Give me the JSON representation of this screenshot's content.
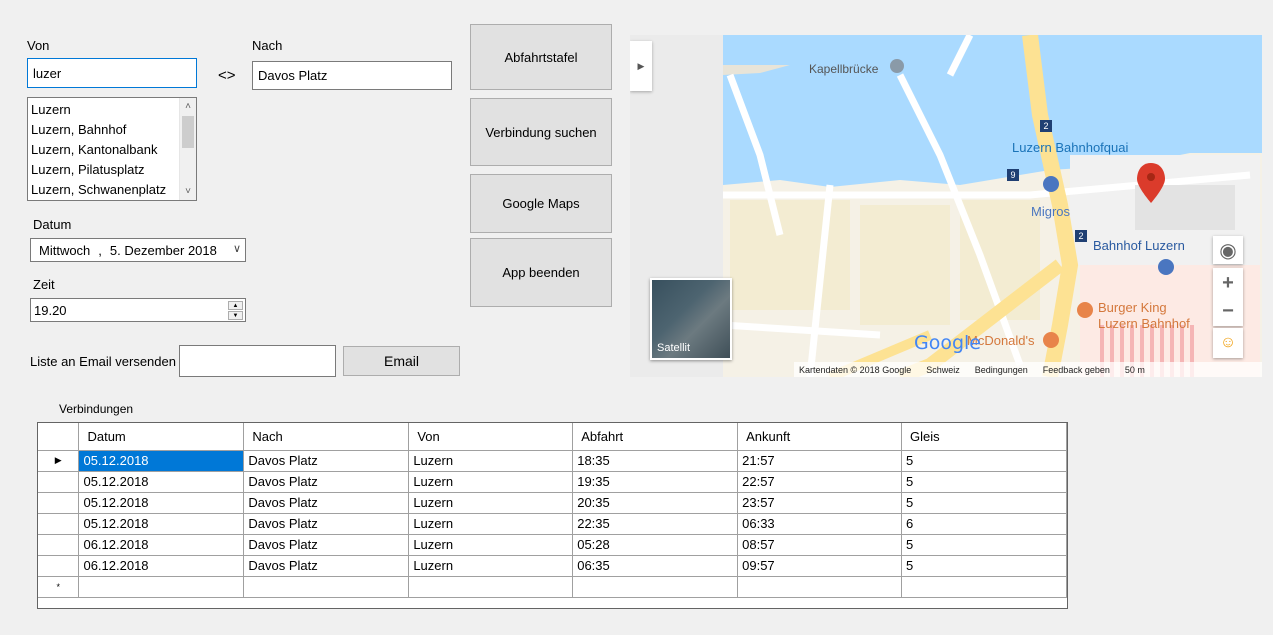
{
  "form": {
    "von_label": "Von",
    "von_value": "luzer",
    "swap_label": "<>",
    "nach_label": "Nach",
    "nach_value": "Davos Platz",
    "suggestions": [
      "Luzern",
      "Luzern, Bahnhof",
      "Luzern, Kantonalbank",
      "Luzern, Pilatusplatz",
      "Luzern, Schwanenplatz"
    ],
    "datum_label": "Datum",
    "datum_weekday": "Mittwoch",
    "datum_sep": ",",
    "datum_value": "5. Dezember 2018",
    "zeit_label": "Zeit",
    "zeit_value": "19.20",
    "email_label": "Liste an Email versenden",
    "email_value": "",
    "email_button": "Email"
  },
  "buttons": {
    "abfahrtstafel": "Abfahrtstafel",
    "verbindung": "Verbindung suchen",
    "google_maps": "Google Maps",
    "beenden": "App beenden"
  },
  "map": {
    "labels": {
      "kapellbruecke": "Kapellbrücke",
      "bahnhofquai": "Luzern Bahnhofquai",
      "migros": "Migros",
      "bahnhof": "Bahnhof Luzern",
      "burger_king_1": "Burger King",
      "burger_king_2": "Luzern Bahnhof",
      "mcdonalds": "McDonald's",
      "route2a": "2",
      "route2b": "2",
      "route9": "9"
    },
    "satellite_label": "Satellit",
    "google_logo": "Google",
    "footer": {
      "kartendaten": "Kartendaten © 2018 Google",
      "schweiz": "Schweiz",
      "bedingungen": "Bedingungen",
      "feedback": "Feedback geben",
      "scale": "50 m"
    },
    "controls": {
      "zoom_in": "+",
      "zoom_out": "−"
    },
    "colors": {
      "water": "#aadaff",
      "road": "#fde293",
      "land": "#f5f1e6",
      "pin": "#db3b2b"
    }
  },
  "table": {
    "caption": "Verbindungen",
    "columns": [
      "Datum",
      "Nach",
      "Von",
      "Abfahrt",
      "Ankunft",
      "Gleis"
    ],
    "rows": [
      [
        "05.12.2018",
        "Davos Platz",
        "Luzern",
        "18:35",
        "21:57",
        "5"
      ],
      [
        "05.12.2018",
        "Davos Platz",
        "Luzern",
        "19:35",
        "22:57",
        "5"
      ],
      [
        "05.12.2018",
        "Davos Platz",
        "Luzern",
        "20:35",
        "23:57",
        "5"
      ],
      [
        "05.12.2018",
        "Davos Platz",
        "Luzern",
        "22:35",
        "06:33",
        "6"
      ],
      [
        "06.12.2018",
        "Davos Platz",
        "Luzern",
        "05:28",
        "08:57",
        "5"
      ],
      [
        "06.12.2018",
        "Davos Platz",
        "Luzern",
        "06:35",
        "09:57",
        "5"
      ]
    ],
    "current_row_marker": "▶",
    "new_row_marker": "*"
  }
}
